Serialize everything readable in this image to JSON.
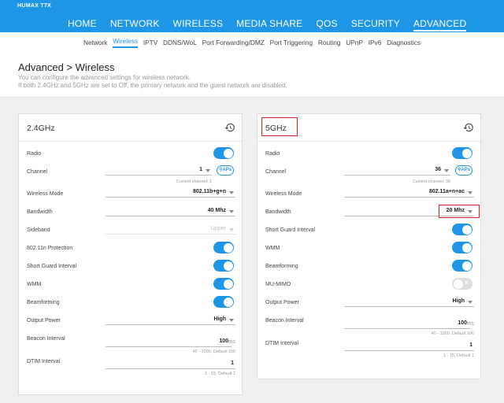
{
  "brand": "HUMAX T7X",
  "main_nav": [
    "HOME",
    "NETWORK",
    "WIRELESS",
    "MEDIA SHARE",
    "QOS",
    "SECURITY",
    "ADVANCED"
  ],
  "main_nav_active": "ADVANCED",
  "sub_nav": [
    "Network",
    "Wireless",
    "IPTV",
    "DDNS/WoL",
    "Port Forwarding/DMZ",
    "Port Triggering",
    "Routing",
    "UPnP",
    "IPv6",
    "Diagnostics"
  ],
  "sub_nav_active": "Wireless",
  "page": {
    "title": "Advanced > Wireless",
    "desc1": "You can configure the advanced settings for wireless network.",
    "desc2": "If both 2.4GHz and 5GHz are set to Off, the primary network and the guest network are disabled."
  },
  "colors": {
    "accent": "#1e96e8",
    "highlight": "#d8202a"
  },
  "card24": {
    "title": "2.4GHz",
    "radio_label": "Radio",
    "channel_label": "Channel",
    "channel_value": "1",
    "aps_label": "APs",
    "channel_hint": "Current channel: 1",
    "mode_label": "Wireless Mode",
    "mode_value": "802.11b+g+n",
    "bandwidth_label": "Bandwidth",
    "bandwidth_value": "40 Mhz",
    "sideband_label": "Sideband",
    "sideband_value": "Upper",
    "protection_label": "802.11n Protection",
    "sgi_label": "Short Guard Interval",
    "wmm_label": "WMM",
    "beamforming_label": "Beamforming",
    "power_label": "Output Power",
    "power_value": "High",
    "beacon_label": "Beacon Interval",
    "beacon_value": "100",
    "beacon_unit": "ms",
    "beacon_hint": "40 - 1000, Default 100",
    "dtim_label": "DTIM Interval",
    "dtim_value": "1",
    "dtim_hint": "1 - 15, Default 1"
  },
  "card5": {
    "title": "5GHz",
    "radio_label": "Radio",
    "channel_label": "Channel",
    "channel_value": "36",
    "aps_label": "APs",
    "channel_hint": "Current channel: 36",
    "mode_label": "Wireless Mode",
    "mode_value": "802.11a+n+ac",
    "bandwidth_label": "Bandwidth",
    "bandwidth_value": "20 Mhz",
    "sgi_label": "Short Guard Interval",
    "wmm_label": "WMM",
    "beamforming_label": "Beamforming",
    "mumimo_label": "MU-MIMO",
    "power_label": "Output Power",
    "power_value": "High",
    "beacon_label": "Beacon Interval",
    "beacon_value": "100",
    "beacon_unit": "ms",
    "beacon_hint": "40 - 1000, Default 100",
    "dtim_label": "DTIM Interval",
    "dtim_value": "1",
    "dtim_hint": "1 - 15, Default 1"
  }
}
